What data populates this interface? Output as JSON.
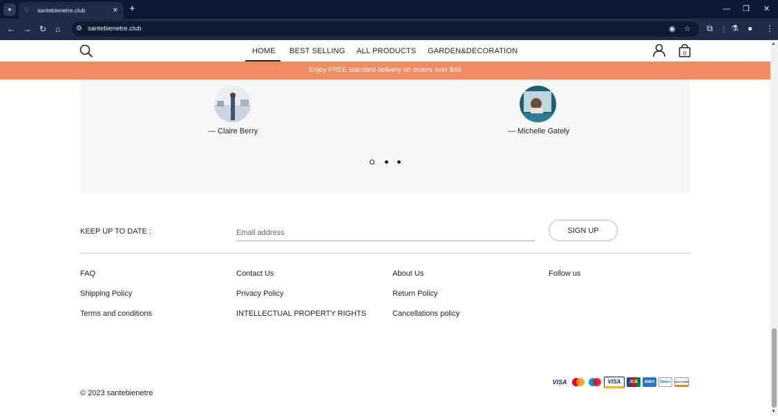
{
  "browser": {
    "tab_title": "santebienetre.club",
    "url": "santebienetre.club"
  },
  "header": {
    "nav": [
      "HOME",
      "BEST SELLING",
      "ALL PRODUCTS",
      "GARDEN&DECORATION"
    ],
    "cart_count": "0"
  },
  "banner": {
    "text": "Enjoy FREE standard delivery on orders over $49"
  },
  "testimonials": {
    "people": [
      "— Claire Berry",
      "— Michelle Gately"
    ],
    "active_slide": 1,
    "slide_count": 3
  },
  "newsletter": {
    "label": "KEEP UP TO DATE :",
    "placeholder": "Email address",
    "button": "SIGN UP"
  },
  "footer": {
    "col1": [
      "FAQ",
      "Shipping Policy",
      "Terms and conditions"
    ],
    "col2": [
      "Contact Us",
      "Privacy Policy",
      "INTELLECTUAL PROPERTY RIGHTS"
    ],
    "col3": [
      "About Us",
      "Return Policy",
      "Cancellations policy"
    ],
    "col4_title": "Follow us",
    "copyright": "© 2023 santebienetre"
  },
  "payments": [
    "VISA",
    "Mastercard",
    "Maestro",
    "VISA",
    "JCB",
    "AMEX",
    "Diners",
    "DISCOVER"
  ],
  "colors": {
    "banner": "#f08b62",
    "chrome": "#0b1a33"
  }
}
